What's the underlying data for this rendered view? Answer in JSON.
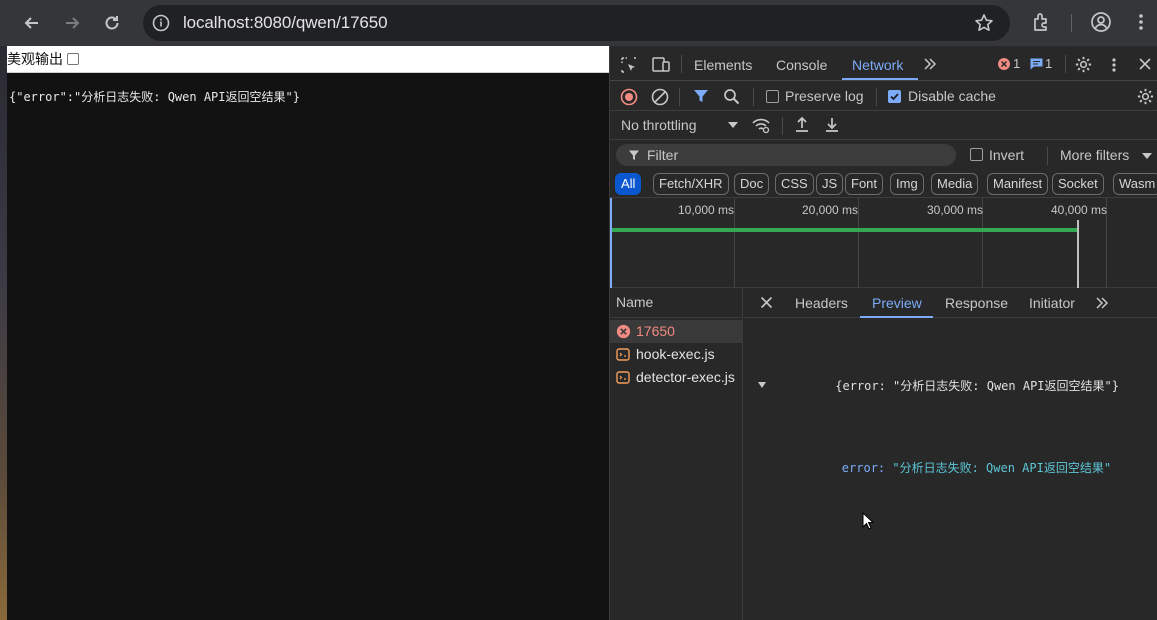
{
  "browser": {
    "url": "localhost:8080/qwen/17650",
    "icons": [
      "back-arrow-icon",
      "forward-arrow-icon",
      "reload-icon",
      "site-info-icon",
      "bookmark-star-icon",
      "extensions-icon",
      "profile-icon",
      "more-vert-icon"
    ]
  },
  "page": {
    "beautify_label": "美观输出",
    "raw_json": "{\"error\":\"分析日志失败: Qwen API返回空结果\"}"
  },
  "devtools": {
    "tabs": [
      "Elements",
      "Console",
      "Network"
    ],
    "active_tab": "Network",
    "error_count": "1",
    "message_count": "1",
    "toolbar": {
      "preserve_log": "Preserve log",
      "disable_cache": "Disable cache",
      "throttling": "No throttling"
    },
    "filter": {
      "placeholder": "Filter",
      "invert": "Invert",
      "more_filters": "More filters"
    },
    "type_filters": [
      "All",
      "Fetch/XHR",
      "Doc",
      "CSS",
      "JS",
      "Font",
      "Img",
      "Media",
      "Manifest",
      "Socket",
      "Wasm"
    ],
    "timeline_ticks": [
      "10,000 ms",
      "20,000 ms",
      "30,000 ms",
      "40,000 ms"
    ],
    "name_header": "Name",
    "requests": [
      {
        "name": "17650",
        "icon": "error-icon"
      },
      {
        "name": "hook-exec.js",
        "icon": "script-icon"
      },
      {
        "name": "detector-exec.js",
        "icon": "script-icon"
      }
    ],
    "detail_tabs": [
      "Headers",
      "Preview",
      "Response",
      "Initiator"
    ],
    "active_detail_tab": "Preview",
    "preview": {
      "summary": "{error: \"分析日志失败: Qwen API返回空结果\"}",
      "key": "error",
      "value": "\"分析日志失败: Qwen API返回空结果\""
    }
  },
  "colors": {
    "accent": "#7cacf8",
    "error": "#f28b82",
    "timeline_bar": "#34a853",
    "preview_key": "#7cacf8",
    "preview_value": "#5cc5d6"
  }
}
